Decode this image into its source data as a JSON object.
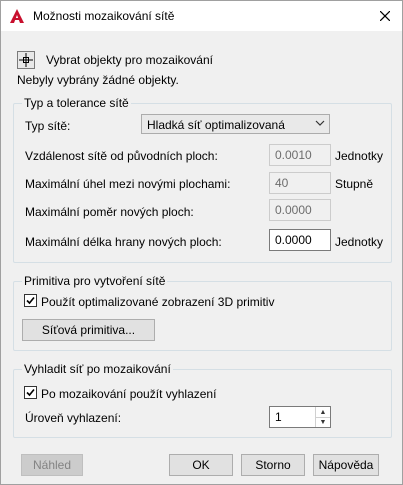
{
  "window": {
    "title": "Možnosti mozaikování sítě"
  },
  "selection": {
    "button_label": "Vybrat objekty pro mozaikování",
    "status": "Nebyly vybrány žádné objekty."
  },
  "mesh_type_group": {
    "title": "Typ a tolerance sítě",
    "type_label": "Typ sítě:",
    "type_value": "Hladká síť optimalizovaná",
    "distance_label": "Vzdálenost sítě od původních ploch:",
    "distance_value": "0.0010",
    "distance_unit": "Jednotky",
    "angle_label": "Maximální úhel mezi novými plochami:",
    "angle_value": "40",
    "angle_unit": "Stupně",
    "ratio_label": "Maximální poměr nových ploch:",
    "ratio_value": "0.0000",
    "edge_label": "Maximální délka hrany nových ploch:",
    "edge_value": "0.0000",
    "edge_unit": "Jednotky"
  },
  "primitives_group": {
    "title": "Primitiva pro vytvoření sítě",
    "checkbox_label": "Použít optimalizované zobrazení 3D primitiv",
    "checked": true,
    "button_label": "Síťová primitiva..."
  },
  "smooth_group": {
    "title": "Vyhladit síť po mozaikování",
    "checkbox_label": "Po mozaikování použít vyhlazení",
    "checked": true,
    "level_label": "Úroveň vyhlazení:",
    "level_value": "1"
  },
  "footer": {
    "preview_label": "Náhled",
    "ok_label": "OK",
    "cancel_label": "Storno",
    "help_label": "Nápověda"
  },
  "colors": {
    "app_icon": "#c8102e",
    "group_border": "#d5dfe5"
  }
}
